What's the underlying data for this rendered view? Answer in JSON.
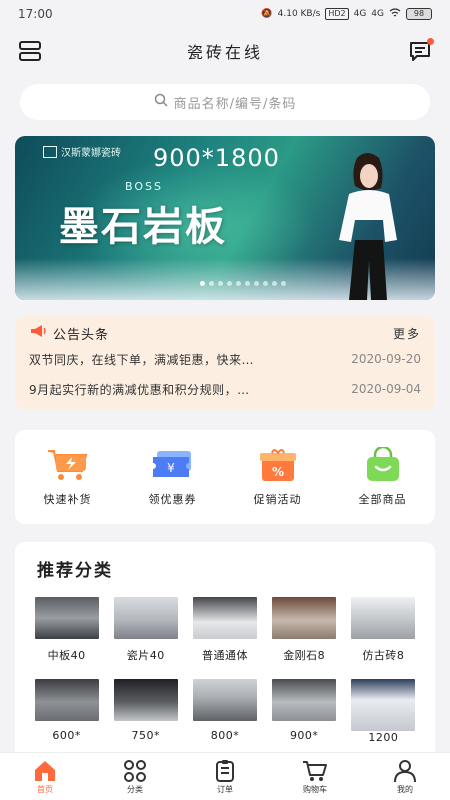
{
  "status": {
    "time": "17:00",
    "net_speed": "4.10 KB/s",
    "sim": "HD2",
    "net1": "4G",
    "net2": "4G",
    "battery": "98"
  },
  "header": {
    "title": "瓷砖在线"
  },
  "search": {
    "placeholder": "商品名称/编号/条码"
  },
  "banner": {
    "brand": "汉斯蒙娜瓷砖",
    "spec": "900*1800",
    "subtitle": "BOSS",
    "headline": "墨石岩板",
    "slide_count": 10,
    "active_slide": 0
  },
  "notice": {
    "title": "公告头条",
    "more": "更多",
    "items": [
      {
        "text": "双节同庆，在线下单，满减钜惠，快来…",
        "date": "2020-09-20"
      },
      {
        "text": "9月起实行新的满减优惠和积分规则，…",
        "date": "2020-09-04"
      }
    ]
  },
  "quick": [
    {
      "label": "快速补货",
      "icon": "cart-bolt-icon"
    },
    {
      "label": "领优惠券",
      "icon": "coupon-icon"
    },
    {
      "label": "促销活动",
      "icon": "gift-percent-icon"
    },
    {
      "label": "全部商品",
      "icon": "shopping-bag-icon"
    }
  ],
  "recommend": {
    "title": "推荐分类",
    "categories": [
      {
        "label": "中板40"
      },
      {
        "label": "瓷片40"
      },
      {
        "label": "普通通体"
      },
      {
        "label": "金刚石8"
      },
      {
        "label": "仿古砖8"
      },
      {
        "label": "600*"
      },
      {
        "label": "750*"
      },
      {
        "label": "800*"
      },
      {
        "label": "900*"
      },
      {
        "label": "1200"
      }
    ]
  },
  "tabs": [
    {
      "label": "首页",
      "icon": "home-icon",
      "active": true
    },
    {
      "label": "分类",
      "icon": "category-icon",
      "active": false
    },
    {
      "label": "订单",
      "icon": "order-icon",
      "active": false
    },
    {
      "label": "购物车",
      "icon": "cart-icon",
      "active": false
    },
    {
      "label": "我的",
      "icon": "user-icon",
      "active": false
    }
  ],
  "colors": {
    "accent": "#ff6a3d",
    "notice_bg": "#fcefe1",
    "page_bg": "#f3f3f5"
  }
}
